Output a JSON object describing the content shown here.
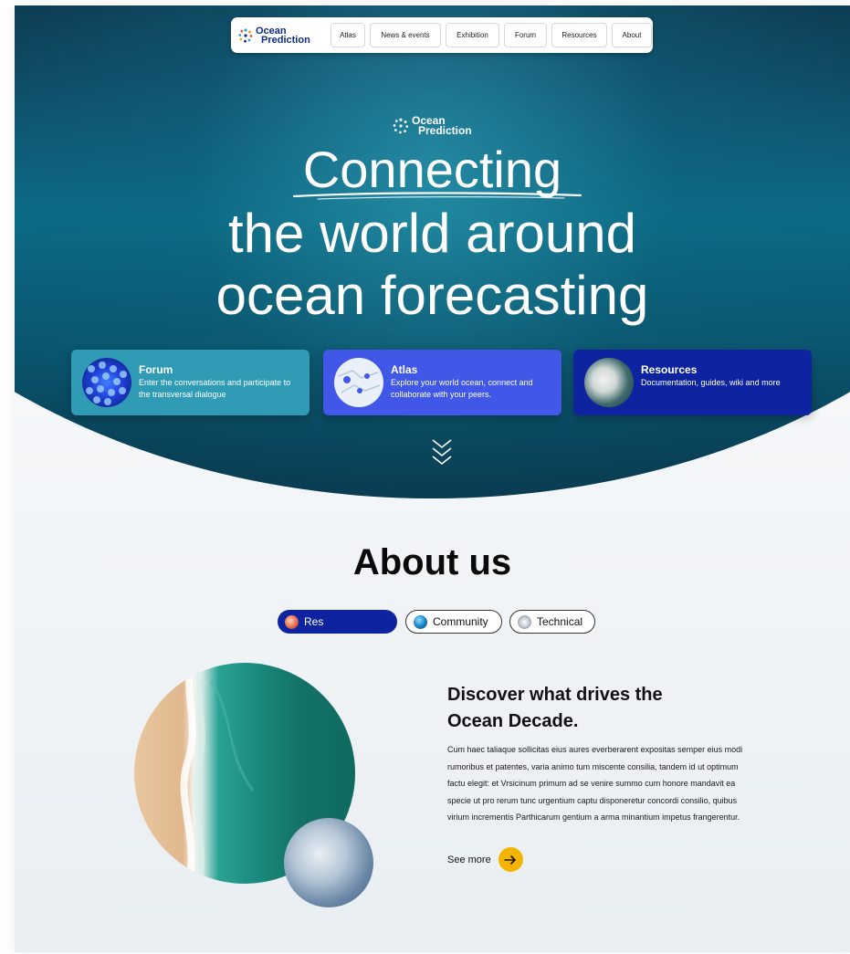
{
  "nav": {
    "logo_line1": "Ocean",
    "logo_line2": "Prediction",
    "items": [
      {
        "label": "Atlas"
      },
      {
        "label": "News & events"
      },
      {
        "label": "Exhibition"
      },
      {
        "label": "Forum"
      },
      {
        "label": "Resources"
      },
      {
        "label": "About"
      }
    ]
  },
  "hero": {
    "logo_line1": "Ocean",
    "logo_line2": "Prediction",
    "title_line1": "Connecting",
    "title_line2": "the world around",
    "title_line3": "ocean forecasting"
  },
  "cards": [
    {
      "title": "Forum",
      "description": "Enter the conversations and participate to the transversal dialogue",
      "color": "#2f9bb5"
    },
    {
      "title": "Atlas",
      "description": "Explore your world ocean, connect and collaborate with your peers.",
      "color": "#4157e8"
    },
    {
      "title": "Resources",
      "description": "Documentation, guides, wiki and more",
      "color": "#0d23a0"
    }
  ],
  "about": {
    "title": "About us",
    "tabs": [
      {
        "label": "Res",
        "active": true
      },
      {
        "label": "Community",
        "active": false
      },
      {
        "label": "Technical",
        "active": false
      }
    ],
    "section_title": "Discover what drives the Ocean Decade.",
    "body": "Cum haec taliaque sollicitas eius aures everberarent expositas semper eius modi rumoribus et patentes, varia animo tum miscente consilia, tandem id ut optimum factu elegit: et Vrsicinum primum ad se venire summo cum honore mandavit ea specie ut pro rerum tunc urgentium captu disponeretur concordi consilio, quibus virium incrementis Parthicarum gentium a arma minantium impetus frangerentur.",
    "see_more": "See more"
  },
  "colors": {
    "accent": "#f4b400",
    "brand_dark": "#0d23a0",
    "brand_mid": "#4157e8",
    "teal": "#2f9bb5"
  }
}
